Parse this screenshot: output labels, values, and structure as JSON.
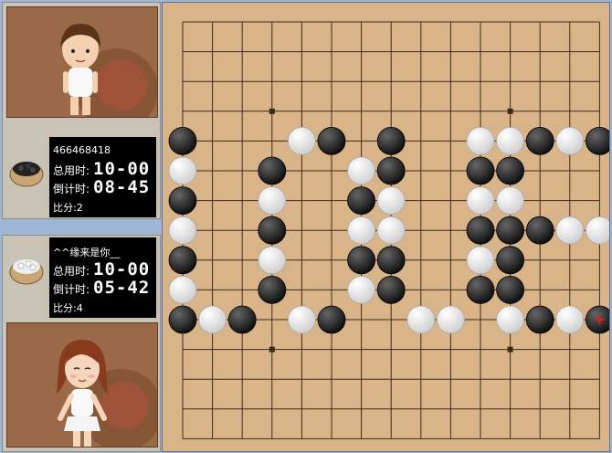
{
  "players": [
    {
      "name": "466468418",
      "stone": "black",
      "total_label": "总用时:",
      "total_time": "10-00",
      "countdown_label": "倒计时:",
      "countdown_time": "08-45",
      "score_label": "比分:2"
    },
    {
      "name": "^^缘来是你__",
      "stone": "white",
      "total_label": "总用时:",
      "total_time": "10-00",
      "countdown_label": "倒计时:",
      "countdown_time": "05-42",
      "score_label": "比分:4"
    }
  ],
  "board": {
    "size": 15,
    "colors": {
      "wood": "#d9b488",
      "line": "#3a2a1a",
      "black": "#111111",
      "white": "#f4f4f4",
      "last_move_marker": "#e02020"
    },
    "star_points": [
      [
        3,
        3
      ],
      [
        11,
        3
      ],
      [
        3,
        11
      ],
      [
        11,
        11
      ]
    ],
    "stones": [
      {
        "c": "b",
        "x": 0,
        "y": 4
      },
      {
        "c": "w",
        "x": 4,
        "y": 4
      },
      {
        "c": "b",
        "x": 5,
        "y": 4
      },
      {
        "c": "b",
        "x": 7,
        "y": 4
      },
      {
        "c": "w",
        "x": 10,
        "y": 4
      },
      {
        "c": "w",
        "x": 11,
        "y": 4
      },
      {
        "c": "b",
        "x": 12,
        "y": 4
      },
      {
        "c": "w",
        "x": 13,
        "y": 4
      },
      {
        "c": "b",
        "x": 14,
        "y": 4
      },
      {
        "c": "w",
        "x": 0,
        "y": 5
      },
      {
        "c": "b",
        "x": 3,
        "y": 5
      },
      {
        "c": "w",
        "x": 6,
        "y": 5
      },
      {
        "c": "b",
        "x": 7,
        "y": 5
      },
      {
        "c": "b",
        "x": 10,
        "y": 5
      },
      {
        "c": "b",
        "x": 11,
        "y": 5
      },
      {
        "c": "b",
        "x": 0,
        "y": 6
      },
      {
        "c": "w",
        "x": 3,
        "y": 6
      },
      {
        "c": "b",
        "x": 6,
        "y": 6
      },
      {
        "c": "w",
        "x": 7,
        "y": 6
      },
      {
        "c": "w",
        "x": 10,
        "y": 6
      },
      {
        "c": "w",
        "x": 11,
        "y": 6
      },
      {
        "c": "w",
        "x": 0,
        "y": 7
      },
      {
        "c": "b",
        "x": 3,
        "y": 7
      },
      {
        "c": "w",
        "x": 6,
        "y": 7
      },
      {
        "c": "w",
        "x": 7,
        "y": 7
      },
      {
        "c": "b",
        "x": 10,
        "y": 7
      },
      {
        "c": "b",
        "x": 11,
        "y": 7
      },
      {
        "c": "b",
        "x": 12,
        "y": 7
      },
      {
        "c": "w",
        "x": 13,
        "y": 7
      },
      {
        "c": "w",
        "x": 14,
        "y": 7
      },
      {
        "c": "b",
        "x": 0,
        "y": 8
      },
      {
        "c": "w",
        "x": 3,
        "y": 8
      },
      {
        "c": "b",
        "x": 6,
        "y": 8
      },
      {
        "c": "b",
        "x": 7,
        "y": 8
      },
      {
        "c": "w",
        "x": 10,
        "y": 8
      },
      {
        "c": "b",
        "x": 11,
        "y": 8
      },
      {
        "c": "w",
        "x": 0,
        "y": 9
      },
      {
        "c": "b",
        "x": 3,
        "y": 9
      },
      {
        "c": "w",
        "x": 6,
        "y": 9
      },
      {
        "c": "b",
        "x": 7,
        "y": 9
      },
      {
        "c": "b",
        "x": 10,
        "y": 9
      },
      {
        "c": "b",
        "x": 11,
        "y": 9
      },
      {
        "c": "b",
        "x": 0,
        "y": 10
      },
      {
        "c": "w",
        "x": 1,
        "y": 10
      },
      {
        "c": "b",
        "x": 2,
        "y": 10
      },
      {
        "c": "w",
        "x": 4,
        "y": 10
      },
      {
        "c": "b",
        "x": 5,
        "y": 10
      },
      {
        "c": "w",
        "x": 8,
        "y": 10
      },
      {
        "c": "w",
        "x": 9,
        "y": 10
      },
      {
        "c": "w",
        "x": 11,
        "y": 10
      },
      {
        "c": "b",
        "x": 12,
        "y": 10
      },
      {
        "c": "w",
        "x": 13,
        "y": 10
      },
      {
        "c": "b",
        "x": 14,
        "y": 10,
        "last": true
      }
    ]
  }
}
